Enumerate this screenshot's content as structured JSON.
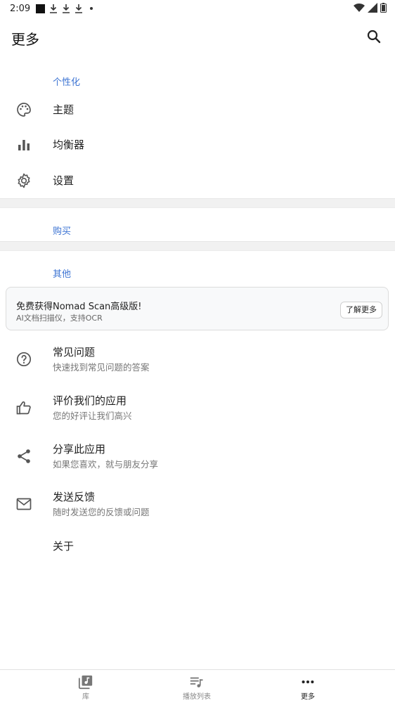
{
  "status_bar": {
    "time": "2:09"
  },
  "app_bar": {
    "title": "更多"
  },
  "sections": {
    "personalization": "个性化",
    "purchase": "购买",
    "other": "其他"
  },
  "personalization_items": [
    {
      "label": "主题",
      "icon": "palette-icon"
    },
    {
      "label": "均衡器",
      "icon": "equalizer-icon"
    },
    {
      "label": "设置",
      "icon": "gear-icon"
    }
  ],
  "promo": {
    "title": "免费获得Nomad Scan高级版!",
    "subtitle": "AI文档扫描仪，支持OCR",
    "button": "了解更多"
  },
  "other_items": [
    {
      "title": "常见问题",
      "subtitle": "快速找到常见问题的答案",
      "icon": "help-circle-icon"
    },
    {
      "title": "评价我们的应用",
      "subtitle": "您的好评让我们高兴",
      "icon": "thumbs-up-icon"
    },
    {
      "title": "分享此应用",
      "subtitle": "如果您喜欢，就与朋友分享",
      "icon": "share-icon"
    },
    {
      "title": "发送反馈",
      "subtitle": "随时发送您的反馈或问题",
      "icon": "mail-icon"
    }
  ],
  "about": "关于",
  "bottom_nav": [
    {
      "label": "库",
      "icon": "library-music-icon"
    },
    {
      "label": "播放列表",
      "icon": "playlist-icon"
    },
    {
      "label": "更多",
      "icon": "more-horizontal-icon",
      "active": true
    }
  ],
  "colors": {
    "accent": "#3d74d3",
    "divider": "#f1f1f1"
  }
}
